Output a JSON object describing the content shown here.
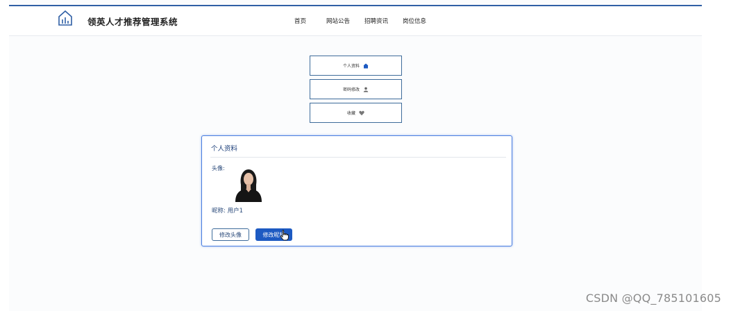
{
  "site": {
    "title": "领英人才推荐管理系统",
    "logo_icon": "building-chart-icon"
  },
  "nav": [
    {
      "label": "首页"
    },
    {
      "label": "网站公告"
    },
    {
      "label": "招聘资讯"
    },
    {
      "label": "岗位信息"
    }
  ],
  "menu": [
    {
      "label": "个人资料",
      "icon": "home-icon"
    },
    {
      "label": "密码修改",
      "icon": "user-icon"
    },
    {
      "label": "收藏",
      "icon": "heart-icon"
    }
  ],
  "profile": {
    "title": "个人资料",
    "avatar_label": "头像:",
    "nickname_label": "昵称:",
    "nickname_value": "用户1",
    "change_avatar_button": "修改头像",
    "change_nickname_button": "修改昵称"
  },
  "colors": {
    "accent": "#1d5ac2",
    "border": "#3d6b9a",
    "top_line": "#2f5fa5"
  },
  "watermark": "CSDN @QQ_785101605"
}
